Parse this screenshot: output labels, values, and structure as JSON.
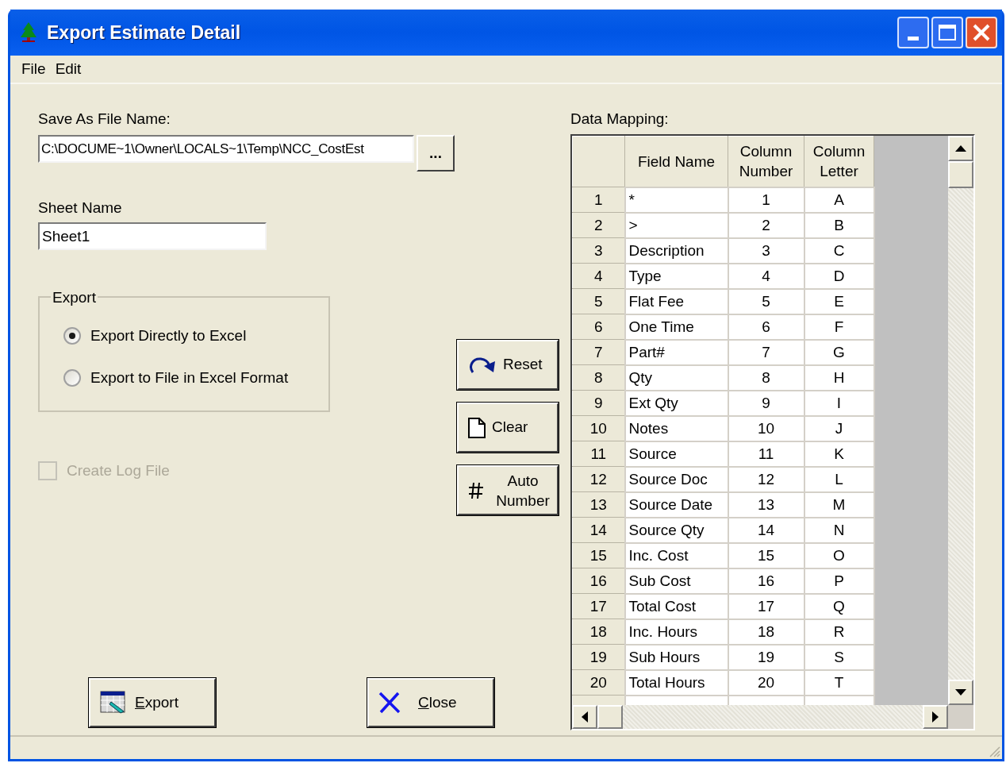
{
  "window": {
    "title": "Export Estimate Detail"
  },
  "menu": [
    "File",
    "Edit"
  ],
  "save_as": {
    "label": "Save As File Name:",
    "value": "C:\\DOCUME~1\\Owner\\LOCALS~1\\Temp\\NCC_CostEst",
    "browse": "..."
  },
  "sheet": {
    "label": "Sheet Name",
    "value": "Sheet1"
  },
  "export_group": {
    "title": "Export",
    "options": [
      {
        "label": "Export Directly to Excel",
        "selected": true
      },
      {
        "label": "Export to File in Excel Format",
        "selected": false
      }
    ]
  },
  "log_file": {
    "label": "Create Log File",
    "checked": false,
    "disabled": true
  },
  "side_buttons": [
    {
      "kind": "reset",
      "label": "Reset"
    },
    {
      "kind": "clear",
      "label": "Clear"
    },
    {
      "kind": "autonumber",
      "label": "Auto Number"
    }
  ],
  "bottom_buttons": [
    {
      "kind": "export",
      "label": "Export",
      "shortcut_underlined": true
    },
    {
      "kind": "close",
      "label": "Close",
      "shortcut_underlined": true
    }
  ],
  "mapping": {
    "label": "Data Mapping:",
    "columns": [
      "",
      "Field Name",
      "Column Number",
      "Column Letter"
    ],
    "rows": [
      [
        "1",
        "*",
        "1",
        "A"
      ],
      [
        "2",
        ">",
        "2",
        "B"
      ],
      [
        "3",
        "Description",
        "3",
        "C"
      ],
      [
        "4",
        "Type",
        "4",
        "D"
      ],
      [
        "5",
        "Flat Fee",
        "5",
        "E"
      ],
      [
        "6",
        "One Time",
        "6",
        "F"
      ],
      [
        "7",
        "Part#",
        "7",
        "G"
      ],
      [
        "8",
        "Qty",
        "8",
        "H"
      ],
      [
        "9",
        "Ext Qty",
        "9",
        "I"
      ],
      [
        "10",
        "Notes",
        "10",
        "J"
      ],
      [
        "11",
        "Source",
        "11",
        "K"
      ],
      [
        "12",
        "Source Doc",
        "12",
        "L"
      ],
      [
        "13",
        "Source Date",
        "13",
        "M"
      ],
      [
        "14",
        "Source Qty",
        "14",
        "N"
      ],
      [
        "15",
        "Inc. Cost",
        "15",
        "O"
      ],
      [
        "16",
        "Sub Cost",
        "16",
        "P"
      ],
      [
        "17",
        "Total Cost",
        "17",
        "Q"
      ],
      [
        "18",
        "Inc. Hours",
        "18",
        "R"
      ],
      [
        "19",
        "Sub Hours",
        "19",
        "S"
      ],
      [
        "20",
        "Total Hours",
        "20",
        "T"
      ]
    ]
  }
}
